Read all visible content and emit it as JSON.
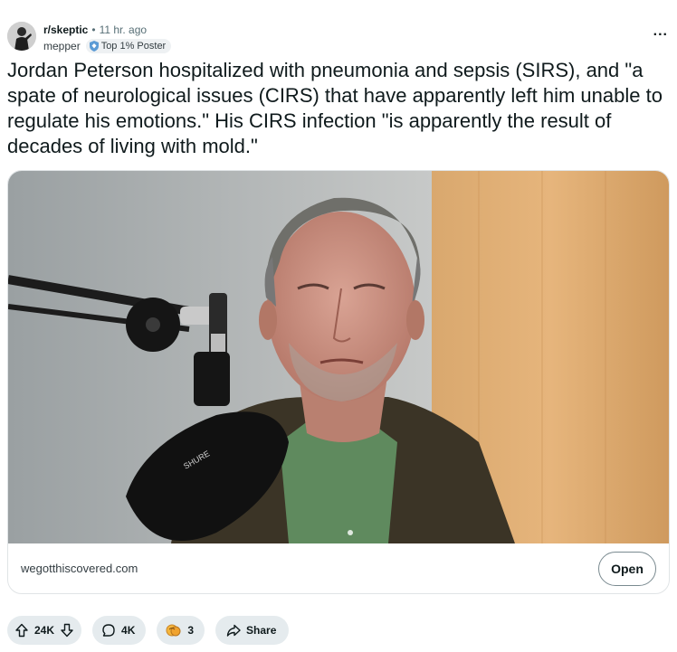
{
  "post": {
    "subreddit": "r/skeptic",
    "separator": "•",
    "time": "11 hr. ago",
    "author": "mepper",
    "flair": "Top 1% Poster",
    "overflow_label": "...",
    "title": "Jordan Peterson hospitalized with pneumonia and sepsis (SIRS), and \"a spate of neurological issues (CIRS) that have apparently left him unable to regulate his emotions.\" His CIRS infection \"is apparently the result of decades of living with mold.\""
  },
  "link": {
    "domain": "wegotthiscovered.com",
    "open_label": "Open",
    "mic_text": "SHURE"
  },
  "actions": {
    "upvotes": "24K",
    "comments": "4K",
    "awards": "3",
    "share_label": "Share"
  },
  "icons": {
    "upvote": "arrow-up-icon",
    "downvote": "arrow-down-icon",
    "comment": "comment-bubble-icon",
    "award": "award-icon",
    "share": "share-arrow-icon",
    "flair": "gem-shield-icon"
  },
  "colors": {
    "text": "#0f1a1c",
    "muted": "#576f76",
    "pill_bg": "#e5ebee",
    "border": "#e0e4e6"
  }
}
